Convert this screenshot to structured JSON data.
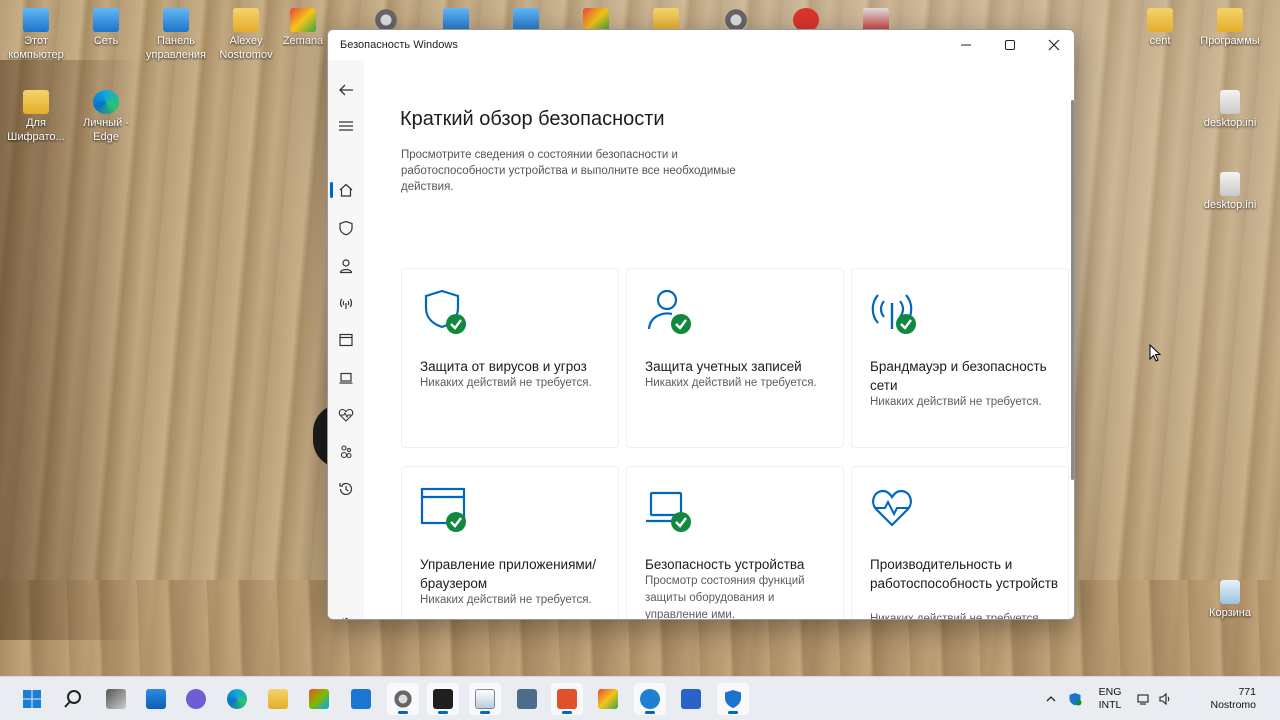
{
  "desktop": {
    "icons_left": [
      {
        "label": "Этот компьютер",
        "icon": "computer-icon"
      },
      {
        "label": "Сеть",
        "icon": "network-icon"
      },
      {
        "label": "Панель управления",
        "icon": "control-panel-icon"
      },
      {
        "label": "Alexey Nostromov",
        "icon": "folder-icon"
      },
      {
        "label": "Zemana",
        "icon": "zemana-icon"
      },
      {
        "label": "Для Шифрато...",
        "icon": "folder-icon"
      },
      {
        "label": "Личный - Edge",
        "icon": "edge-icon"
      }
    ],
    "icons_right": [
      {
        "label": "cent",
        "icon": "folder-icon"
      },
      {
        "label": "Программы",
        "icon": "folder-icon"
      },
      {
        "label": "desktop.ini",
        "icon": "file-icon"
      },
      {
        "label": "desktop.ini",
        "icon": "file-icon"
      },
      {
        "label": "Корзина",
        "icon": "recycle-bin-icon"
      }
    ]
  },
  "window": {
    "title": "Безопасность Windows",
    "page_title": "Краткий обзор безопасности",
    "page_subtitle": "Просмотрите сведения о состоянии безопасности и работоспособности устройства и выполните все необходимые действия.",
    "cards": [
      {
        "title": "Защита от вирусов и угроз",
        "desc": "Никаких действий не требуется.",
        "icon": "virus-shield-icon"
      },
      {
        "title": "Защита учетных записей",
        "desc": "Никаких действий не требуется.",
        "icon": "account-person-icon"
      },
      {
        "title": "Брандмауэр и безопасность сети",
        "desc": "Никаких действий не требуется.",
        "icon": "firewall-antenna-icon"
      },
      {
        "title": "Управление приложениями/браузером",
        "desc": "Никаких действий не требуется.",
        "icon": "app-browser-icon"
      },
      {
        "title": "Безопасность устройства",
        "desc": "Просмотр состояния функций защиты оборудования и управление ими.",
        "icon": "laptop-icon"
      },
      {
        "title": "Производительность и работоспособность устройств",
        "desc": "Никаких действий не требуется.",
        "icon": "heart-pulse-icon"
      }
    ],
    "status_color": "#10893e",
    "accent_color": "#0067c0"
  },
  "tray": {
    "lang_top": "ENG",
    "lang_bottom": "INTL",
    "time": "771",
    "user": "Nostromo"
  }
}
